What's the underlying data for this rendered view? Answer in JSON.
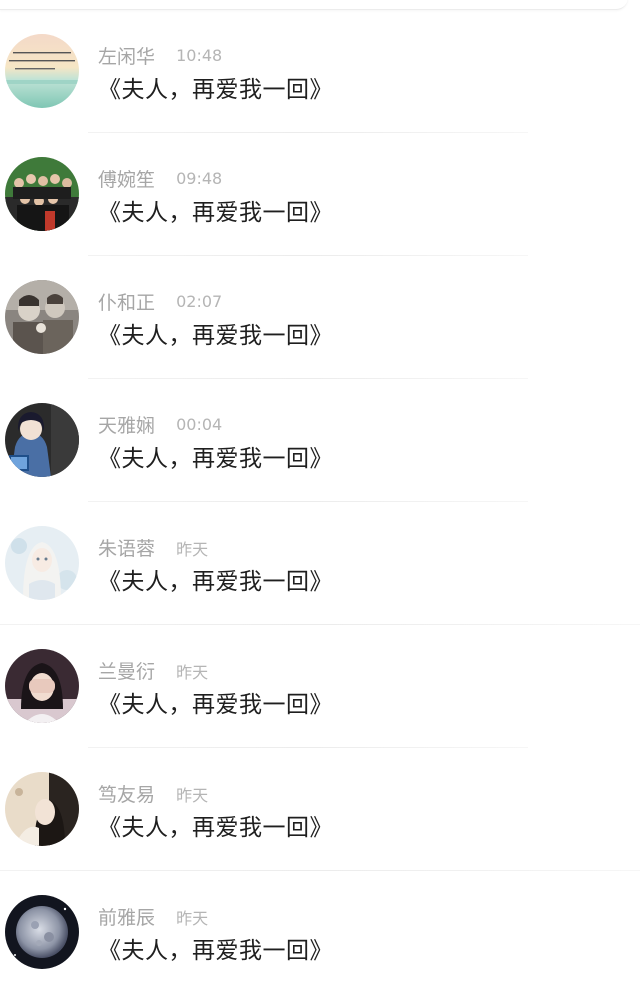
{
  "conversations": [
    {
      "name": "左闲华",
      "time": "10:48",
      "message": "《夫人，再爱我一回》",
      "avatar": "landscape-avatar"
    },
    {
      "name": "傅婉笙",
      "time": "09:48",
      "message": "《夫人，再爱我一回》",
      "avatar": "group-photo-avatar"
    },
    {
      "name": "仆和正",
      "time": "02:07",
      "message": "《夫人，再爱我一回》",
      "avatar": "children-photo-avatar"
    },
    {
      "name": "天雅娴",
      "time": "00:04",
      "message": "《夫人，再爱我一回》",
      "avatar": "anime-girl-avatar"
    },
    {
      "name": "朱语蓉",
      "time": "昨天",
      "message": "《夫人，再爱我一回》",
      "avatar": "illustrated-girl-avatar"
    },
    {
      "name": "兰曼衍",
      "time": "昨天",
      "message": "《夫人，再爱我一回》",
      "avatar": "girl-covering-face-avatar"
    },
    {
      "name": "笃友易",
      "time": "昨天",
      "message": "《夫人，再爱我一回》",
      "avatar": "woman-profile-avatar"
    },
    {
      "name": "前雅辰",
      "time": "昨天",
      "message": "《夫人，再爱我一回》",
      "avatar": "moon-avatar"
    }
  ],
  "colors": {
    "name_text": "#a6a6a6",
    "time_text": "#b5b5b5",
    "message_text": "#1f1f1f",
    "divider": "#ececec",
    "background": "#ffffff"
  }
}
